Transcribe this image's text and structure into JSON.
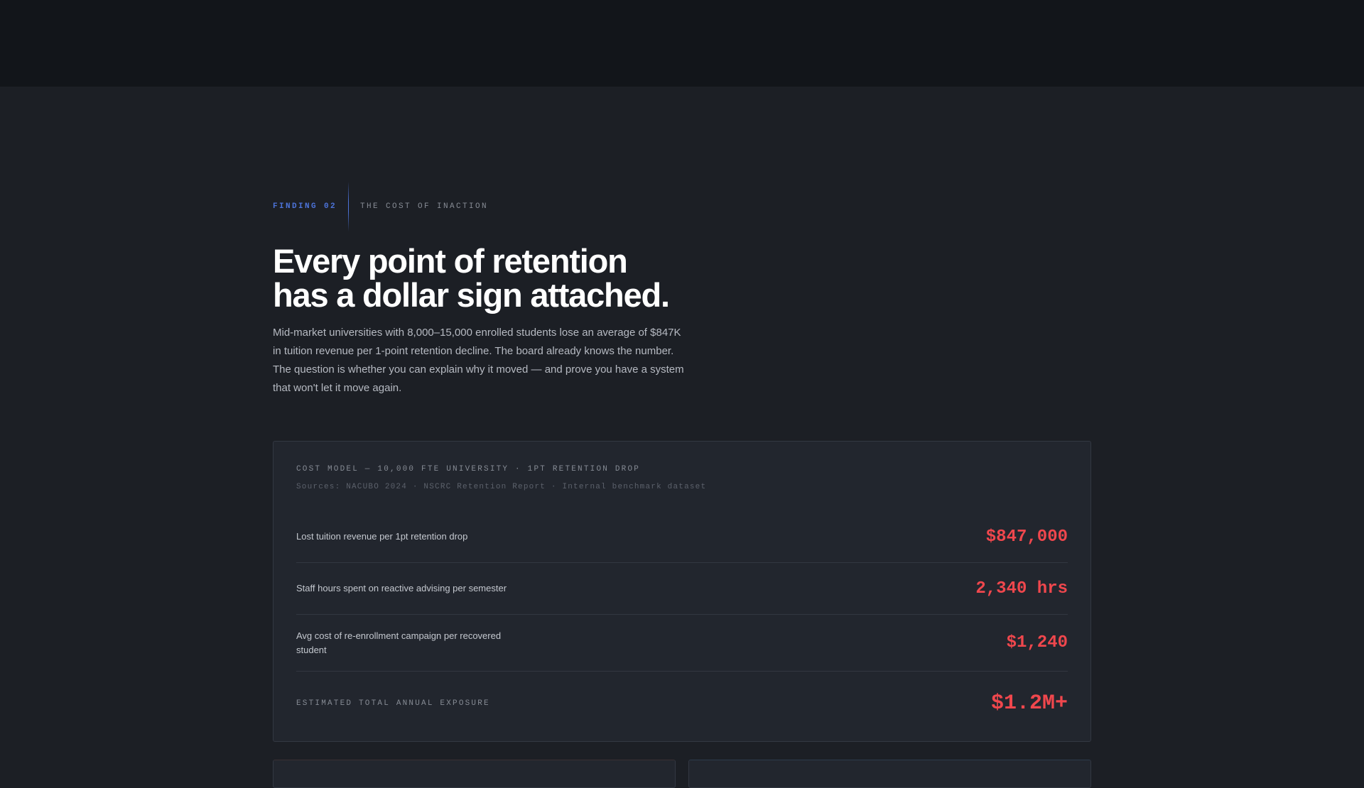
{
  "eyebrow": {
    "finding": "FINDING 02",
    "topic": "THE COST OF INACTION"
  },
  "headline": {
    "line1": "Every point of retention",
    "line2": "has a dollar sign attached."
  },
  "lede": "Mid-market universities with 8,000–15,000 enrolled students lose an average of $847K in tuition revenue per 1-point retention decline. The board already knows the number. The question is whether you can explain why it moved — and prove you have a system that won't let it move again.",
  "cost_model": {
    "title": "COST MODEL — 10,000 FTE UNIVERSITY · 1PT RETENTION DROP",
    "sources": "Sources: NACUBO 2024 · NSCRC Retention Report · Internal benchmark dataset",
    "rows": [
      {
        "label": "Lost tuition revenue per 1pt retention drop",
        "value": "$847,000"
      },
      {
        "label": "Staff hours spent on reactive advising per semester",
        "value": "2,340 hrs"
      },
      {
        "label": "Avg cost of re-enrollment campaign per recovered student",
        "value": "$1,240"
      }
    ],
    "total": {
      "label": "ESTIMATED TOTAL ANNUAL EXPOSURE",
      "value": "$1.2M+"
    }
  },
  "colors": {
    "accent_blue": "#4c73d9",
    "alert_red": "#f0474d",
    "background": "#1c1f25",
    "topbar": "#12151a"
  }
}
